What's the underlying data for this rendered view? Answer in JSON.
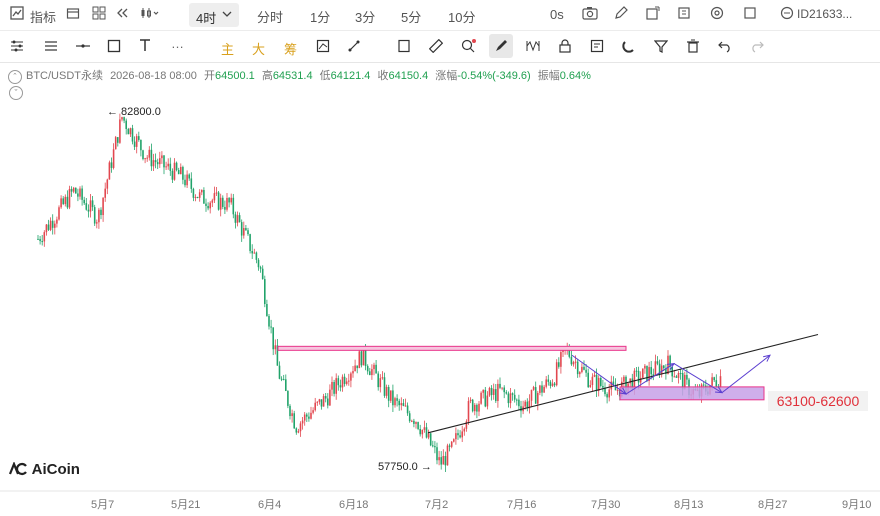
{
  "toolbar": {
    "indicators_label": "指标",
    "timeframe_selected": "4时",
    "timeframes": [
      "分时",
      "1分",
      "3分",
      "5分",
      "10分"
    ],
    "countdown": "0s",
    "account_id": "ID21633...",
    "draw_tools": [
      "主",
      "大",
      "筹"
    ]
  },
  "ohlc": {
    "symbol": "BTC/USDT永续",
    "time": "2026-08-18 08:00",
    "open_label": "开",
    "open": "64500.1",
    "high_label": "高",
    "high": "64531.4",
    "low_label": "低",
    "low": "64121.4",
    "close_label": "收",
    "close": "64150.4",
    "change_label": "涨幅",
    "change": "-0.54%(-349.6)",
    "amp_label": "振幅",
    "amp": "0.64%"
  },
  "annotations": {
    "high_note": "← 82800.0",
    "low_note": "57750.0 →",
    "zone_label": "63100-62600"
  },
  "logo": "AiCoin",
  "colors": {
    "up": "#e2474f",
    "down": "#21a36a",
    "resistance": "#e8348a",
    "zone": "#c7a0e8",
    "arrow": "#5b3fd0"
  },
  "chart_data": {
    "type": "candlestick",
    "symbol": "BTC/USDT永续",
    "interval": "4h",
    "x_ticks": [
      "5月7",
      "5月21",
      "6月4",
      "6月18",
      "7月2",
      "7月16",
      "7月30",
      "8月13",
      "8月27",
      "9月10"
    ],
    "swing_path": [
      {
        "date": "2026-04-26",
        "price": 74000
      },
      {
        "date": "2026-05-02",
        "price": 77500
      },
      {
        "date": "2026-05-06",
        "price": 75500
      },
      {
        "date": "2026-05-10",
        "price": 82800
      },
      {
        "date": "2026-05-14",
        "price": 80000
      },
      {
        "date": "2026-05-20",
        "price": 78500
      },
      {
        "date": "2026-05-23",
        "price": 77000
      },
      {
        "date": "2026-05-28",
        "price": 76500
      },
      {
        "date": "2026-06-02",
        "price": 72000
      },
      {
        "date": "2026-06-05",
        "price": 64500
      },
      {
        "date": "2026-06-08",
        "price": 60500
      },
      {
        "date": "2026-06-13",
        "price": 62500
      },
      {
        "date": "2026-06-19",
        "price": 65600
      },
      {
        "date": "2026-06-24",
        "price": 62300
      },
      {
        "date": "2026-06-28",
        "price": 61000
      },
      {
        "date": "2026-07-01",
        "price": 58700
      },
      {
        "date": "2026-07-02",
        "price": 57750
      },
      {
        "date": "2026-07-04",
        "price": 58800
      },
      {
        "date": "2026-07-07",
        "price": 62000
      },
      {
        "date": "2026-07-12",
        "price": 63000
      },
      {
        "date": "2026-07-16",
        "price": 62000
      },
      {
        "date": "2026-07-21",
        "price": 64000
      },
      {
        "date": "2026-07-23",
        "price": 66000
      },
      {
        "date": "2026-07-27",
        "price": 63800
      },
      {
        "date": "2026-07-31",
        "price": 63000
      },
      {
        "date": "2026-08-05",
        "price": 64200
      },
      {
        "date": "2026-08-09",
        "price": 65000
      },
      {
        "date": "2026-08-12",
        "price": 63400
      },
      {
        "date": "2026-08-14",
        "price": 62700
      },
      {
        "date": "2026-08-18",
        "price": 64150
      }
    ],
    "high_marker": {
      "price": 82800.0
    },
    "low_marker": {
      "price": 57750.0
    },
    "resistance": {
      "price": 66100,
      "from": "2026-06-05",
      "to": "2026-08-02"
    },
    "support_zone": {
      "price_high": 63100,
      "price_low": 62600,
      "from": "2026-08-01",
      "to": "2026-08-25",
      "label": "63100-62600"
    },
    "trendline": [
      {
        "date": "2026-06-30",
        "price": 60000
      },
      {
        "date": "2026-09-03",
        "price": 67100
      }
    ],
    "projection_path": [
      {
        "date": "2026-07-24",
        "price": 65600
      },
      {
        "date": "2026-08-02",
        "price": 62800
      },
      {
        "date": "2026-08-10",
        "price": 65000
      },
      {
        "date": "2026-08-18",
        "price": 62900
      },
      {
        "date": "2026-08-26",
        "price": 65600
      }
    ]
  }
}
